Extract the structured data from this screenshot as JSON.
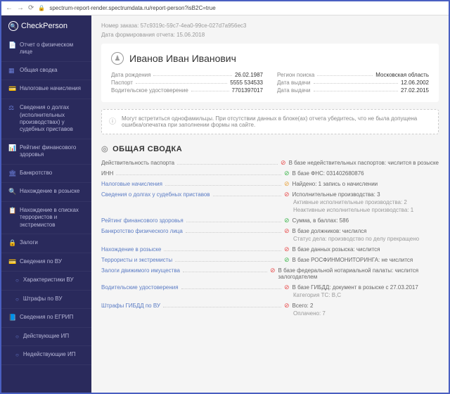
{
  "browser": {
    "url": "spectrum-report-render.spectrumdata.ru/report-person?isB2C=true"
  },
  "brand": "CheckPerson",
  "sidebar": {
    "items": [
      {
        "label": "Отчет о физическом лице",
        "icon": "doc"
      },
      {
        "label": "Общая сводка",
        "icon": "grid"
      },
      {
        "label": "Налоговые начисления",
        "icon": "card"
      },
      {
        "label": "Сведения о долгах (исполнительных производствах) у судебных приставов",
        "icon": "scale"
      },
      {
        "label": "Рейтинг финансового здоровья",
        "icon": "chart"
      },
      {
        "label": "Банкротство",
        "icon": "bank"
      },
      {
        "label": "Нахождение в розыске",
        "icon": "search"
      },
      {
        "label": "Нахождение в списках террористов и экстремистов",
        "icon": "list"
      },
      {
        "label": "Залоги",
        "icon": "lock"
      },
      {
        "label": "Сведения по ВУ",
        "icon": "card"
      },
      {
        "label": "Характеристики ВУ",
        "sub": true
      },
      {
        "label": "Штрафы по ВУ",
        "sub": true
      },
      {
        "label": "Сведения по ЕГРИП",
        "icon": "book"
      },
      {
        "label": "Действующие ИП",
        "sub": true
      },
      {
        "label": "Недействующие ИП",
        "sub": true
      }
    ]
  },
  "order": {
    "id_label": "Номер заказа:",
    "id": "57c9319c-59c7-4ea0-99ce-027d7a956ec3",
    "date_label": "Дата формирования отчета:",
    "date": "15.06.2018"
  },
  "person": {
    "name": "Иванов Иван Иванович",
    "rows_left": [
      {
        "lbl": "Дата рождения",
        "val": "26.02.1987"
      },
      {
        "lbl": "Паспорт",
        "val": "5555 534533"
      },
      {
        "lbl": "Водительское удостоверение",
        "val": "7701397017"
      }
    ],
    "rows_right": [
      {
        "lbl": "Регион поиска",
        "val": "Московская область"
      },
      {
        "lbl": "Дата выдачи",
        "val": "12.06.2002"
      },
      {
        "lbl": "Дата выдачи",
        "val": "27.02.2015"
      }
    ]
  },
  "notice": "Могут встретиться однофамильцы. При отсутствии данных в блоке(ах) отчета убедитесь, что не была допущена ошибка/опечатка при заполнении формы на сайте.",
  "summary": {
    "title": "ОБЩАЯ СВОДКА",
    "rows": [
      {
        "lbl": "Действительность паспорта",
        "plain": true,
        "lines": [
          {
            "s": "red",
            "t": "В базе недействительных паспортов: числится в розыске"
          }
        ]
      },
      {
        "lbl": "ИНН",
        "plain": true,
        "lines": [
          {
            "s": "green",
            "t": "В базе ФНС: 031402680876"
          }
        ]
      },
      {
        "lbl": "Налоговые начисления",
        "lines": [
          {
            "s": "yellow",
            "t": "Найдено: 1 запись о начислении"
          }
        ]
      },
      {
        "lbl": "Сведения о долгах у судебных приставов",
        "lines": [
          {
            "s": "red",
            "t": "Исполнительные производства: 3"
          }
        ],
        "subs": [
          "Активные исполнительные производства: 2",
          "Неактивные исполнительные производства: 1"
        ]
      },
      {
        "lbl": "Рейтинг финансового здоровья",
        "lines": [
          {
            "s": "green",
            "t": "Сумма, в баллах: 586"
          }
        ]
      },
      {
        "lbl": "Банкротство физического лица",
        "lines": [
          {
            "s": "red",
            "t": "В базе должников: числился"
          }
        ],
        "subs": [
          "Статус дела: производство по делу прекращено"
        ]
      },
      {
        "lbl": "Нахождение в розыске",
        "lines": [
          {
            "s": "red",
            "t": "В базе данных розыска: числится"
          }
        ]
      },
      {
        "lbl": "Террористы и экстремисты",
        "lines": [
          {
            "s": "green",
            "t": "В базе РОСФИНМОНИТОРИНГА: не числится"
          }
        ]
      },
      {
        "lbl": "Залоги движимого имущества",
        "lines": [
          {
            "s": "red",
            "t": "В базе федеральной нотариальной палаты: числится залогодателем"
          }
        ]
      },
      {
        "lbl": "Водительские удостоверения",
        "lines": [
          {
            "s": "red",
            "t": "В базе ГИБДД: документ в розыске с 27.03.2017"
          }
        ],
        "subs": [
          "Категория ТС: B,C"
        ]
      },
      {
        "lbl": "Штрафы ГИБДД по ВУ",
        "lines": [
          {
            "s": "red",
            "t": "Всего: 2"
          }
        ],
        "subs": [
          "Оплачено: 7"
        ]
      }
    ]
  }
}
